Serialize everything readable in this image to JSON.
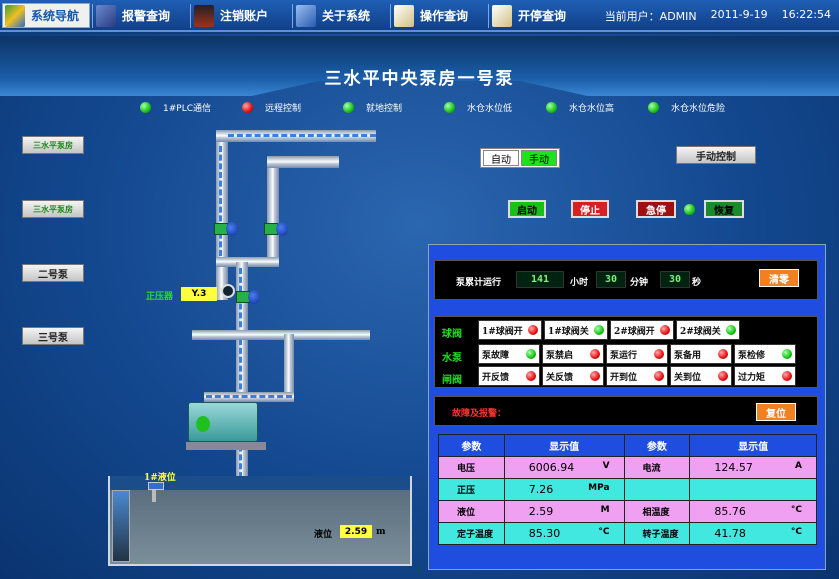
{
  "menubar": {
    "items": [
      {
        "label": "系统导航",
        "icon": "navigation-icon",
        "active": true
      },
      {
        "label": "报警查询",
        "icon": "alarm-query-icon"
      },
      {
        "label": "注销账户",
        "icon": "logout-icon"
      },
      {
        "label": "关于系统",
        "icon": "about-icon"
      },
      {
        "label": "操作查询",
        "icon": "operation-log-icon"
      },
      {
        "label": "开停查询",
        "icon": "start-stop-log-icon"
      }
    ],
    "user": "当前用户：ADMIN",
    "date": "2011-9-19",
    "time": "16:22:54"
  },
  "title": "三水平中央泵房一号泵",
  "indicators": [
    {
      "label": "1#PLC通信",
      "color": "green"
    },
    {
      "label": "远程控制",
      "color": "red"
    },
    {
      "label": "就地控制",
      "color": "green"
    },
    {
      "label": "水仓水位低",
      "color": "green"
    },
    {
      "label": "水仓水位高",
      "color": "green"
    },
    {
      "label": "水仓水位危险",
      "color": "green"
    }
  ],
  "pumps": [
    "三水平泵房",
    "三水平泵房",
    "二号泵",
    "三号泵"
  ],
  "mode": {
    "auto": "自动",
    "manual": "手动"
  },
  "manual_control": "手动控制",
  "controls": {
    "start": "启动",
    "stop": "停止",
    "estop": "急停",
    "reset": "恢复"
  },
  "pressure_gauge": {
    "label": "正压器",
    "value": "Y.3"
  },
  "runtime": {
    "label": "泵累计运行",
    "hours": "141",
    "hours_unit": "小时",
    "minutes": "30",
    "minutes_unit": "分钟",
    "seconds": "30",
    "seconds_unit": "秒",
    "clear": "清零"
  },
  "rows": [
    {
      "label": "球阀",
      "cells": [
        {
          "t": "1#球阀开",
          "c": "red"
        },
        {
          "t": "1#球阀关",
          "c": "green"
        },
        {
          "t": "2#球阀开",
          "c": "red"
        },
        {
          "t": "2#球阀关",
          "c": "green"
        }
      ]
    },
    {
      "label": "水泵",
      "cells": [
        {
          "t": "泵故障",
          "c": "green"
        },
        {
          "t": "泵禁启",
          "c": "red"
        },
        {
          "t": "泵运行",
          "c": "red"
        },
        {
          "t": "泵备用",
          "c": "red"
        },
        {
          "t": "泵检修",
          "c": "green"
        }
      ]
    },
    {
      "label": "闸阀",
      "cells": [
        {
          "t": "开反馈",
          "c": "red"
        },
        {
          "t": "关反馈",
          "c": "red"
        },
        {
          "t": "开到位",
          "c": "red"
        },
        {
          "t": "关到位",
          "c": "red"
        },
        {
          "t": "过力矩",
          "c": "red"
        }
      ]
    }
  ],
  "fault": {
    "label": "故障及报警：",
    "reset": "复位"
  },
  "params": {
    "headers": [
      "参数",
      "显示值",
      "参数",
      "显示值"
    ],
    "rows": [
      {
        "k1": "电压",
        "v1": "6006.94",
        "u1": "V",
        "k2": "电流",
        "v2": "124.57",
        "u2": "A"
      },
      {
        "k1": "正压",
        "v1": "7.26",
        "u1": "MPa",
        "k2": "",
        "v2": "",
        "u2": ""
      },
      {
        "k1": "液位",
        "v1": "2.59",
        "u1": "M",
        "k2": "相温度",
        "v2": "85.76",
        "u2": "°C"
      },
      {
        "k1": "定子温度",
        "v1": "85.30",
        "u1": "°C",
        "k2": "转子温度",
        "v2": "41.78",
        "u2": "°C"
      }
    ]
  },
  "tank": {
    "sensor_label": "1#液位",
    "level_label": "液位",
    "level_value": "2.59",
    "level_unit": "m"
  }
}
